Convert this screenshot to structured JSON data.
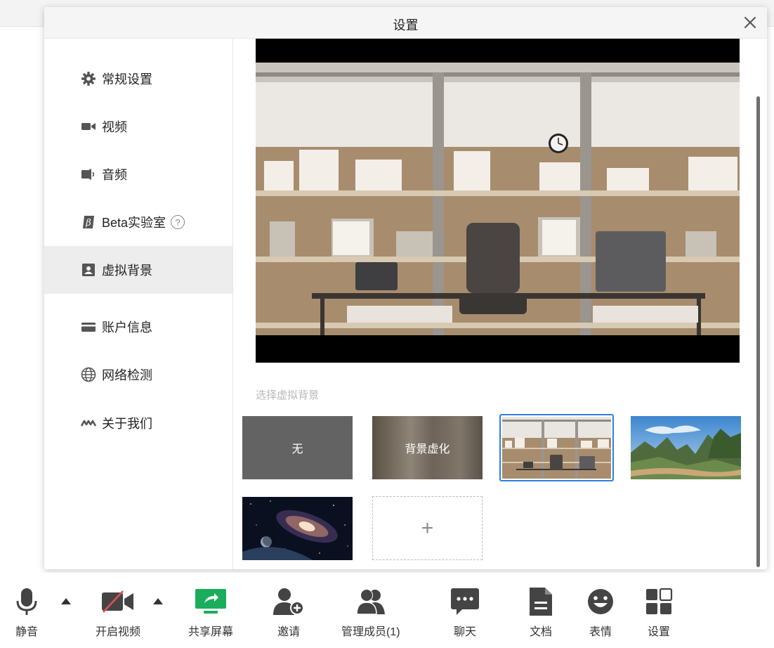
{
  "dialog": {
    "title": "设置",
    "close_icon": "close-icon"
  },
  "sidebar": {
    "items": [
      {
        "label": "常规设置",
        "icon": "gear-icon"
      },
      {
        "label": "视频",
        "icon": "video-camera-icon"
      },
      {
        "label": "音频",
        "icon": "speaker-icon"
      },
      {
        "label": "Beta实验室",
        "icon": "beta-icon",
        "help": "?"
      },
      {
        "label": "虚拟背景",
        "icon": "portrait-icon",
        "active": true
      },
      {
        "label": "账户信息",
        "icon": "card-icon"
      },
      {
        "label": "网络检测",
        "icon": "globe-icon"
      },
      {
        "label": "关于我们",
        "icon": "logo-icon"
      }
    ]
  },
  "content": {
    "section_label": "选择虚拟背景",
    "tiles": [
      {
        "label": "无"
      },
      {
        "label": "背景虚化"
      },
      {
        "label": "",
        "selected": true
      },
      {
        "label": ""
      },
      {
        "label": ""
      },
      {
        "label": "+"
      }
    ],
    "selected_color": "#2f7fe0"
  },
  "toolbar": {
    "items": [
      {
        "label": "静音",
        "icon": "microphone-icon"
      },
      {
        "label": "开启视频",
        "icon": "video-off-icon"
      },
      {
        "label": "共享屏幕",
        "icon": "share-screen-icon"
      },
      {
        "label": "邀请",
        "icon": "invite-user-icon"
      },
      {
        "label": "管理成员(1)",
        "icon": "members-icon"
      },
      {
        "label": "聊天",
        "icon": "chat-icon"
      },
      {
        "label": "文档",
        "icon": "document-icon"
      },
      {
        "label": "表情",
        "icon": "emoji-icon"
      },
      {
        "label": "设置",
        "icon": "settings-grid-icon"
      }
    ],
    "share_color": "#1aad5c"
  }
}
